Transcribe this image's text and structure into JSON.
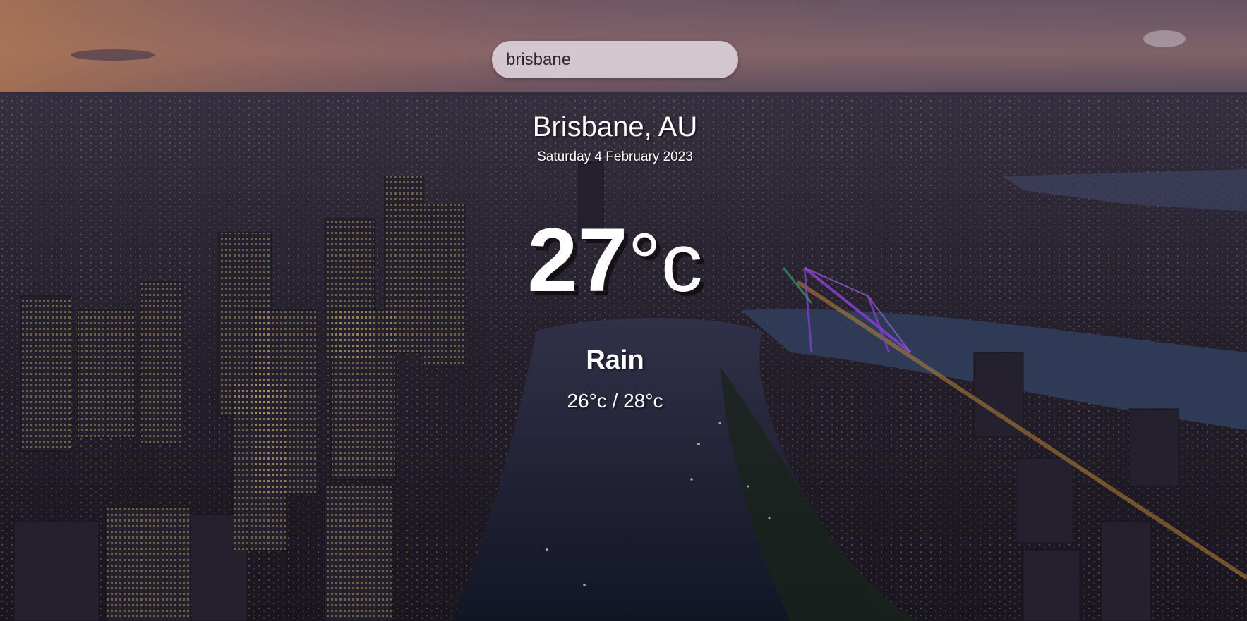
{
  "search": {
    "value": "brisbane",
    "icon": "search-input-field"
  },
  "location": {
    "city": "Brisbane, AU",
    "date": "Saturday 4 February 2023"
  },
  "weather": {
    "temp": "27",
    "unit": "°c",
    "condition": "Rain",
    "hi_low": "26°c / 28°c"
  },
  "background": {
    "subject": "aerial city view at dusk",
    "sky_top": "#6b5a6e",
    "sky_horizon": "#c98a6a",
    "river_color": "#1c2436",
    "bridge_color": "#8a3fd0"
  }
}
